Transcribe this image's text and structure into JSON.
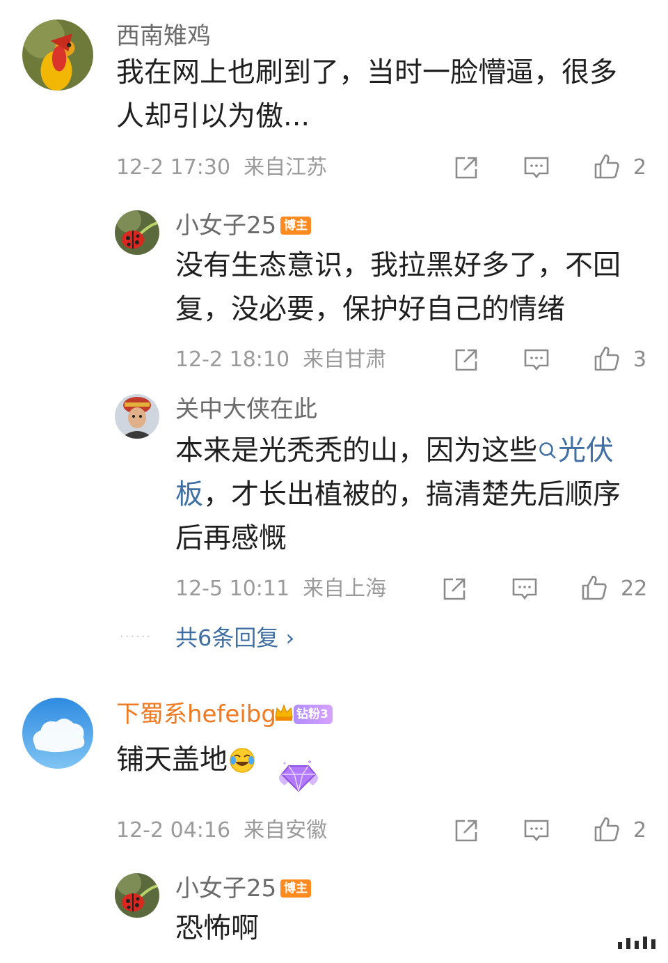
{
  "comments": [
    {
      "username": "西南雉鸡",
      "text": "我在网上也刷到了，当时一脸懵逼，很多人却引以为傲...",
      "time": "12-2 17:30",
      "location": "来自江苏",
      "likes": "2",
      "replies": [
        {
          "username": "小女子25",
          "badge": "博主",
          "text": "没有生态意识，我拉黑好多了，不回复，没必要，保护好自己的情绪",
          "time": "12-2 18:10",
          "location": "来自甘肃",
          "likes": "3"
        },
        {
          "username": "关中大侠在此",
          "text_before": "本来是光秃秃的山，因为这些",
          "link_text": "光伏板",
          "text_after": "，才长出植被的，搞清楚先后顺序后再感慨",
          "time": "12-5 10:11",
          "location": "来自上海",
          "likes": "22"
        }
      ],
      "more_replies": "共6条回复 ›",
      "more_dots": "······"
    },
    {
      "username": "下蜀系hefeibg",
      "fan_badge": "钻粉3",
      "text": "铺天盖地",
      "time": "12-2 04:16",
      "location": "来自安徽",
      "likes": "2",
      "replies": [
        {
          "username": "小女子25",
          "badge": "博主",
          "text": "恐怖啊"
        }
      ]
    }
  ],
  "colors": {
    "accent_link": "#3f6fa3",
    "badge_blogger": "#ff8a1f",
    "username_gray": "#6b6b6b",
    "username_orange": "#f07a22"
  },
  "icons": [
    "share-icon",
    "comment-icon",
    "like-icon",
    "search-icon",
    "laugh-cry-emoji",
    "diamond-sticker",
    "crown-icon"
  ]
}
